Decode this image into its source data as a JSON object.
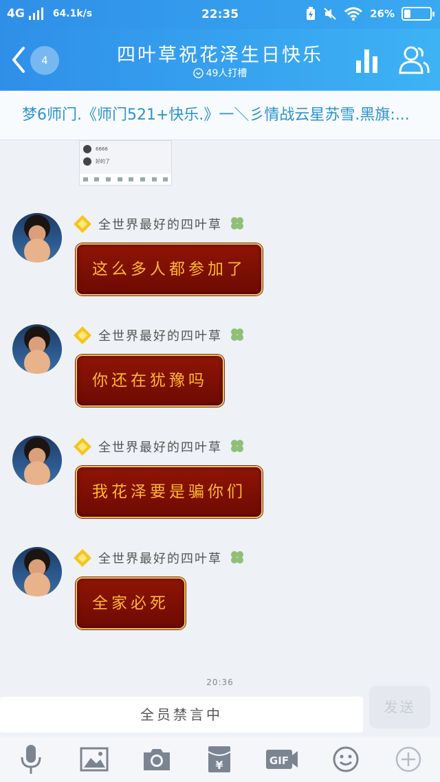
{
  "status_bar": {
    "network": "4G",
    "speed": "64.1k/s",
    "time": "22:35",
    "battery_percent": "26%",
    "battery_level": 0.26
  },
  "header": {
    "back_badge": "4",
    "title": "四叶草祝花泽生日快乐",
    "subtitle": "49人打槽"
  },
  "announcement": "梦6师门.《师门521+快乐.》一＼彡情战云星苏雪.黑旗:...",
  "thumbnail": {
    "rows": [
      "6666",
      "好的了"
    ]
  },
  "messages": [
    {
      "sender": "全世界最好的四叶草",
      "text": "这么多人都参加了"
    },
    {
      "sender": "全世界最好的四叶草",
      "text": "你还在犹豫吗"
    },
    {
      "sender": "全世界最好的四叶草",
      "text": "我花泽要是骗你们"
    },
    {
      "sender": "全世界最好的四叶草",
      "text": "全家必死"
    }
  ],
  "timestamp": "20:36",
  "input": {
    "muted_text": "全员禁言中",
    "send_label": "发送"
  },
  "toolbar": {
    "icons": [
      "microphone-icon",
      "image-icon",
      "camera-icon",
      "red-packet-icon",
      "gif-icon",
      "emoji-icon",
      "plus-icon"
    ],
    "gif_label": "GIF"
  },
  "colors": {
    "header_blue": "#2f8fe8",
    "bubble_red": "#8e1505",
    "bubble_text": "#ffb830",
    "notice_text": "#2a93cc"
  }
}
